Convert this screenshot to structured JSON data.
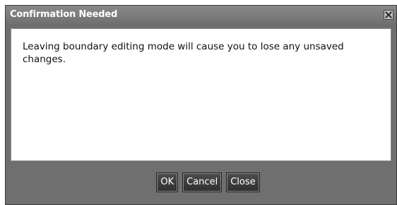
{
  "dialog": {
    "title": "Confirmation Needed",
    "close_icon": "close-icon",
    "message": "Leaving boundary editing mode will cause you to lose any unsaved changes.",
    "buttons": {
      "ok": "OK",
      "cancel": "Cancel",
      "close": "Close"
    }
  },
  "colors": {
    "frame": "#6f6f6f",
    "titlebar": "#7c7c7c",
    "button": "#3a3a3a",
    "content_bg": "#ffffff"
  }
}
